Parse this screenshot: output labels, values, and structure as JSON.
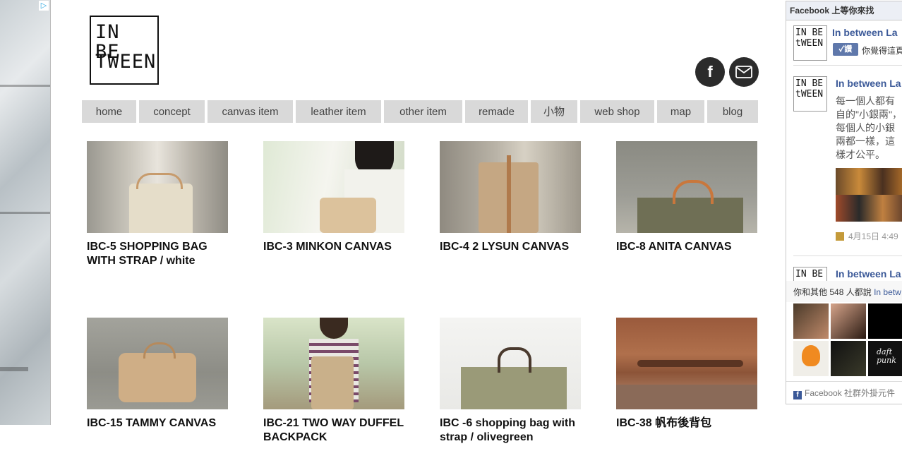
{
  "ad": {
    "badge_icon": "adchoices-icon"
  },
  "logo": {
    "line1": "IN BE",
    "line2": "TWEEN"
  },
  "social": {
    "facebook_icon": "f",
    "mail_icon": "mail-icon"
  },
  "nav": [
    {
      "label": "home"
    },
    {
      "label": "concept"
    },
    {
      "label": "canvas item"
    },
    {
      "label": "leather item"
    },
    {
      "label": "other item"
    },
    {
      "label": "remade"
    },
    {
      "label": "小物"
    },
    {
      "label": "web shop"
    },
    {
      "label": "map"
    },
    {
      "label": "blog"
    }
  ],
  "products": [
    {
      "title": "IBC-5 SHOPPING BAG WITH STRAP / white"
    },
    {
      "title": "IBC-3 MINKON CANVAS"
    },
    {
      "title": "IBC-4 2 LYSUN CANVAS"
    },
    {
      "title": "IBC-8 ANITA CANVAS"
    },
    {
      "title": "IBC-15 TAMMY CANVAS"
    },
    {
      "title": "IBC-21 TWO WAY DUFFEL BACKPACK"
    },
    {
      "title": "IBC -6 shopping bag with strap / olivegreen"
    },
    {
      "title": "IBC-38 帆布後背包"
    }
  ],
  "fb": {
    "header": "Facebook 上等你來找",
    "page_name": "In between La",
    "like_label": "讚",
    "like_note": "你覺得這頁",
    "post_page_name": "In between La",
    "post_text": "每一個人都有自的\"小銀兩\"，每個人的小銀兩都一樣，這樣才公平。",
    "post_time": "4月15日 4:49",
    "post3_name": "In between La",
    "friends_prefix": "你和其他",
    "friends_count": "548",
    "friends_suffix": "人都說",
    "friends_page": "In betw",
    "footer": "Facebook 社群外掛元件"
  }
}
